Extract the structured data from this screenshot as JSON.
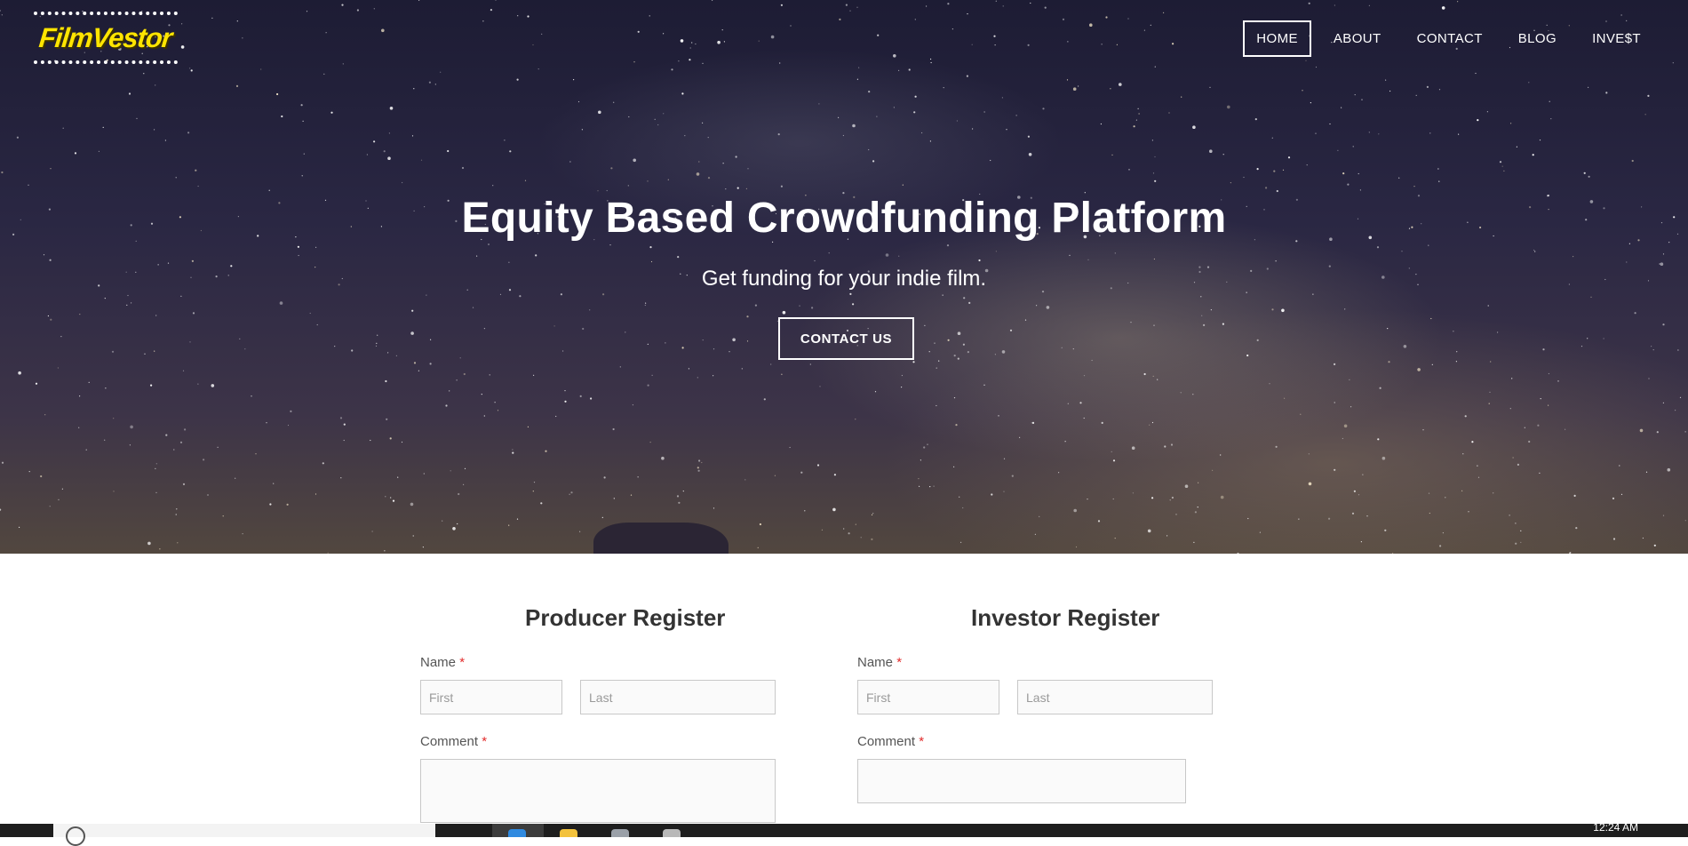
{
  "brand": {
    "logo_text": "FilmVestor"
  },
  "nav": {
    "items": [
      {
        "label": "HOME",
        "active": true
      },
      {
        "label": "ABOUT",
        "active": false
      },
      {
        "label": "CONTACT",
        "active": false
      },
      {
        "label": "BLOG",
        "active": false
      },
      {
        "label": "INVE$T",
        "active": false
      }
    ]
  },
  "hero": {
    "title": "Equity Based Crowdfunding Platform",
    "subtitle": "Get funding for your indie film.",
    "cta_label": "CONTACT US"
  },
  "producer_form": {
    "title": "Producer Register",
    "name_label": "Name",
    "required_mark": "*",
    "first_placeholder": "First",
    "last_placeholder": "Last",
    "comment_label": "Comment"
  },
  "investor_form": {
    "title": "Investor Register",
    "name_label": "Name",
    "required_mark": "*",
    "first_placeholder": "First",
    "last_placeholder": "Last",
    "comment_label": "Comment"
  },
  "taskbar": {
    "clock": "12:24 AM",
    "apps": [
      "edge-icon",
      "file-explorer-icon",
      "network-icon",
      "app-icon"
    ]
  },
  "colors": {
    "logo_yellow": "#ffe500",
    "required_red": "#e22c2c",
    "nav_text": "#ffffff",
    "heading_text": "#333333"
  }
}
